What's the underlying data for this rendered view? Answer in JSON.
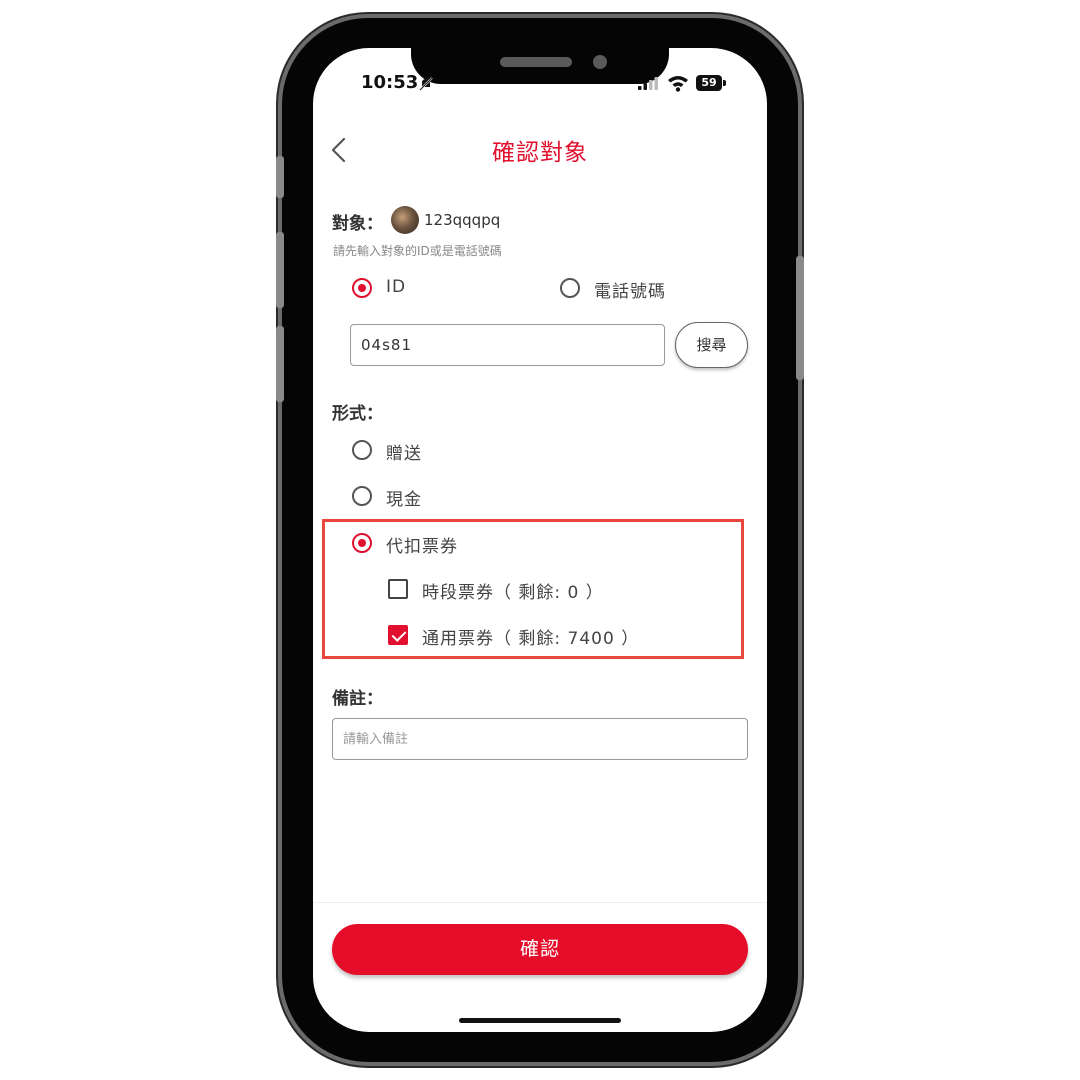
{
  "status_bar": {
    "time": "10:53",
    "battery": "59"
  },
  "header": {
    "title": "確認對象"
  },
  "target": {
    "label": "對象：",
    "name": "123qqqpq",
    "hint": "請先輸入對象的ID或是電話號碼"
  },
  "search_type": {
    "options": [
      {
        "label": "ID",
        "selected": true
      },
      {
        "label": "電話號碼",
        "selected": false
      }
    ],
    "input_value": "04s81",
    "search_button": "搜尋"
  },
  "form": {
    "label": "形式：",
    "options": [
      {
        "label": "贈送",
        "selected": false
      },
      {
        "label": "現金",
        "selected": false
      },
      {
        "label": "代扣票券",
        "selected": true
      }
    ],
    "tickets": [
      {
        "label": "時段票券（ 剩餘: 0 ）",
        "checked": false
      },
      {
        "label": "通用票券（ 剩餘: 7400 ）",
        "checked": true
      }
    ]
  },
  "note": {
    "label": "備註：",
    "placeholder": "請輸入備註"
  },
  "footer": {
    "confirm_label": "確認"
  },
  "colors": {
    "accent": "#e0102e",
    "button": "#e60d2a",
    "highlight_border": "#e8483c"
  }
}
